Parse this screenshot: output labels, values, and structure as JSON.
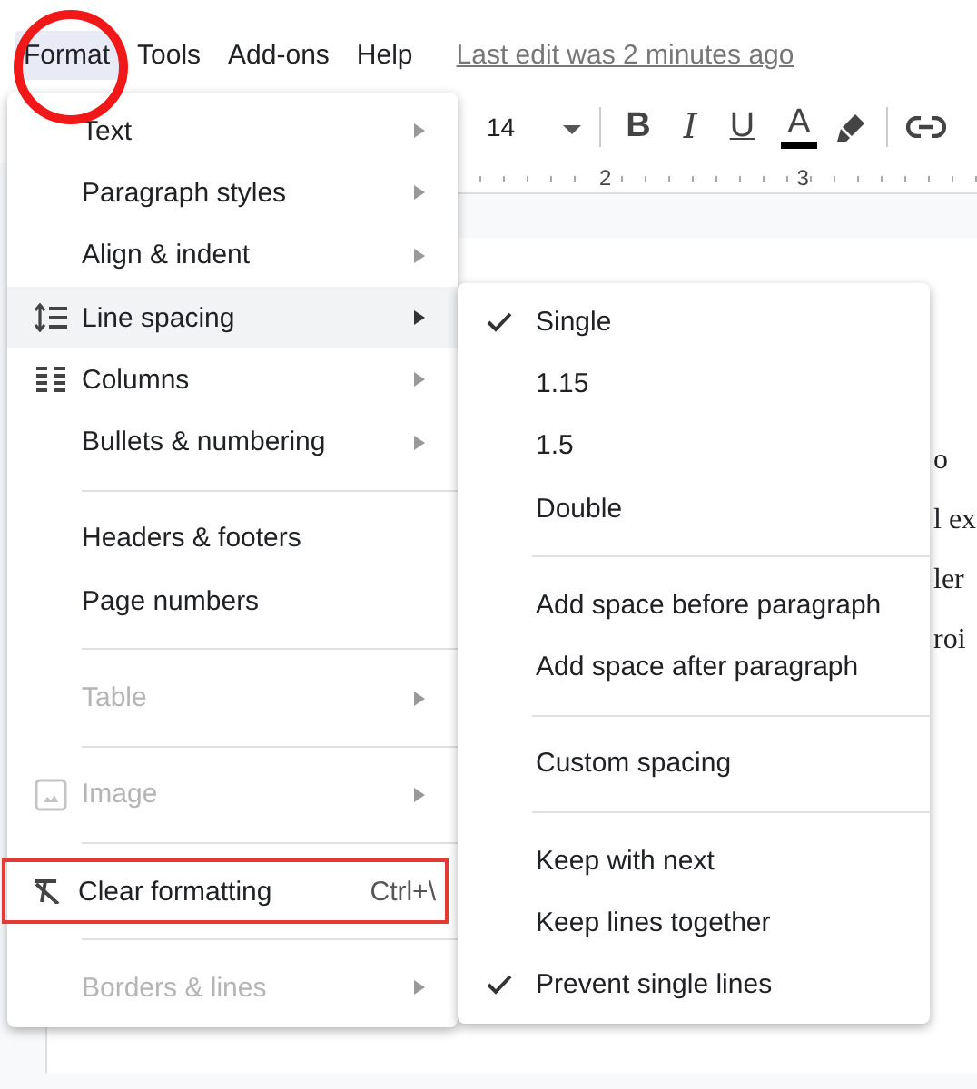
{
  "menubar": [
    {
      "label": "Format",
      "selected": true,
      "annotated": true
    },
    {
      "label": "Tools",
      "selected": false,
      "annotated": false
    },
    {
      "label": "Add-ons",
      "selected": false,
      "annotated": false
    },
    {
      "label": "Help",
      "selected": false,
      "annotated": false
    }
  ],
  "last_edit": "Last edit was 2 minutes ago",
  "toolbar": {
    "font_size": "14",
    "buttons": [
      "B",
      "I",
      "U",
      "A"
    ]
  },
  "ruler": [
    "2",
    "3"
  ],
  "document_lines": [
    "o",
    "l ex",
    "ler",
    "roi"
  ],
  "format_menu": [
    {
      "kind": "item",
      "label": "Text",
      "submenu": true,
      "disabled": false,
      "selected": false,
      "annotated": false
    },
    {
      "kind": "item",
      "label": "Paragraph styles",
      "submenu": true,
      "disabled": false,
      "selected": false,
      "annotated": false
    },
    {
      "kind": "item",
      "label": "Align & indent",
      "submenu": true,
      "disabled": false,
      "selected": false,
      "annotated": false
    },
    {
      "kind": "item",
      "label": "Line spacing",
      "submenu": true,
      "disabled": false,
      "selected": true,
      "annotated": false
    },
    {
      "kind": "item",
      "label": "Columns",
      "submenu": true,
      "disabled": false,
      "selected": false,
      "annotated": false
    },
    {
      "kind": "item",
      "label": "Bullets & numbering",
      "submenu": true,
      "disabled": false,
      "selected": false,
      "annotated": false
    },
    {
      "kind": "divider"
    },
    {
      "kind": "item",
      "label": "Headers & footers",
      "submenu": false,
      "disabled": false,
      "selected": false,
      "annotated": false
    },
    {
      "kind": "item",
      "label": "Page numbers",
      "submenu": false,
      "disabled": false,
      "selected": false,
      "annotated": false
    },
    {
      "kind": "divider"
    },
    {
      "kind": "item",
      "label": "Table",
      "submenu": true,
      "disabled": true,
      "selected": false,
      "annotated": false
    },
    {
      "kind": "divider"
    },
    {
      "kind": "item",
      "label": "Image",
      "submenu": true,
      "disabled": true,
      "selected": false,
      "annotated": false
    },
    {
      "kind": "divider"
    },
    {
      "kind": "item",
      "label": "Clear formatting",
      "shortcut": "Ctrl+\\",
      "submenu": false,
      "disabled": false,
      "selected": false,
      "annotated": true
    },
    {
      "kind": "divider"
    },
    {
      "kind": "item",
      "label": "Borders & lines",
      "submenu": true,
      "disabled": true,
      "selected": false,
      "annotated": false
    }
  ],
  "line_spacing_menu": [
    {
      "kind": "item",
      "label": "Single",
      "checked": true
    },
    {
      "kind": "item",
      "label": "1.15",
      "checked": false
    },
    {
      "kind": "item",
      "label": "1.5",
      "checked": false
    },
    {
      "kind": "item",
      "label": "Double",
      "checked": false
    },
    {
      "kind": "divider"
    },
    {
      "kind": "item",
      "label": "Add space before paragraph",
      "checked": false
    },
    {
      "kind": "item",
      "label": "Add space after paragraph",
      "checked": false
    },
    {
      "kind": "divider"
    },
    {
      "kind": "item",
      "label": "Custom spacing",
      "checked": false
    },
    {
      "kind": "divider"
    },
    {
      "kind": "item",
      "label": "Keep with next",
      "checked": false
    },
    {
      "kind": "item",
      "label": "Keep lines together",
      "checked": false
    },
    {
      "kind": "item",
      "label": "Prevent single lines",
      "checked": true
    }
  ]
}
